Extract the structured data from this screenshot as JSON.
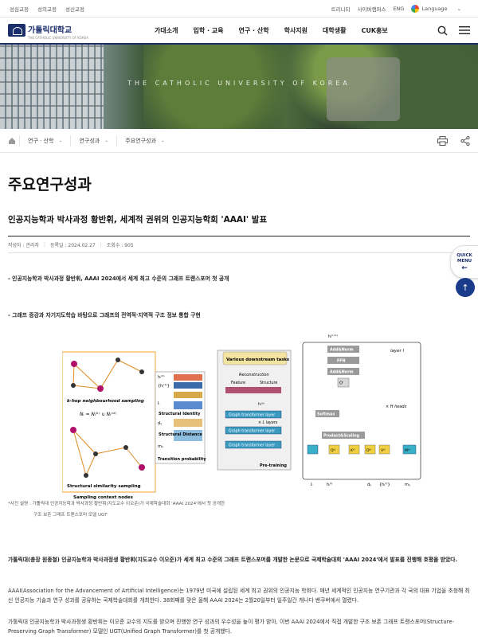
{
  "topbar": {
    "left_links": [
      "성심교정",
      "성의교정",
      "성신교정"
    ],
    "right_links": [
      "트리니티",
      "사이버캠퍼스",
      "ENG"
    ],
    "language": "Language"
  },
  "header": {
    "logo_text": "가톨릭대학교",
    "logo_sub": "THE CATHOLIC UNIVERSITY OF KOREA",
    "nav": [
      "가대소개",
      "입학 · 교육",
      "연구 · 산학",
      "학사지원",
      "대학생활",
      "CUK홍보"
    ]
  },
  "banner": {
    "text": "THE CATHOLIC UNIVERSITY OF KOREA"
  },
  "breadcrumb": [
    "연구 · 산학",
    "연구성과",
    "주요연구성과"
  ],
  "page_title": "주요연구성과",
  "article": {
    "title": "인공지능학과 박사과정 황반휘, 세계적 권위의 인공지능학회 'AAAI' 발표",
    "author_label": "작성자 : 관리자",
    "date_label": "등록일 : 2024.02.27",
    "views_label": "조회수 : 905",
    "bullet1": "- 인공지능학과 박사과정 황반휘, AAAI 2024에서 세계 최고 수준의 그래프 트랜스포머 첫 공개",
    "bullet2": "- 그래프 증강과 자기지도학습 바탕으로 그래프의 전역적·지역적 구조 정보 통합 구현",
    "caption1": "*사진 설명 : 가톨릭대 인공지능학과 박사과정 황반휘(지도교수 이오준)가 국제학술대회 'AAAI 2024'에서 첫 공개한",
    "caption2": "구조 보존 그래프 트랜스포머 모델 UGT",
    "para1": "가톨릭대(총장 원종철) 인공지능학과 박사과정생 황반휘(지도교수 이오준)가 세계 최고 수준의 그래프 트랜스포머를 개발한 논문으로 국제학술대회 'AAAI 2024'에서 발표를 진행해 호평을 받았다.",
    "para2": "AAAI(Association for the Advancement of Artificial Intelligence)는 1979년 미국에 설립된 세계 최고 권위의 인공지능 학회다. 매년 세계적인 인공지능 연구기관과 각 국의 대표 기업을 초청해 최신 인공지능 기술과 연구 성과를 공유하는 국제학술대회를 개최한다. 38회째를 맞은 올해 AAAI 2024는 2월20일부터 일주일간 캐나다 밴쿠버에서 열렸다.",
    "para3": "가톨릭대 인공지능학과 박사과정생 황반휘는 이오준 교수의 지도를 받으며 진행한 연구 성과의 우수성을 높이 평가 받아, 이번 AAAI 2024에서 직접 개발한 구조 보존 그래프 트랜스포머(Structure-Preserving Graph Transformer) 모델인 UGT(Unified Graph Transformer)를 첫 공개했다."
  },
  "figure": {
    "labels": {
      "khop": "k-hop neighbourhood sampling",
      "khop_formula": "Nᵢ = Nᵢ⁽ᵏ⁾ ∪ Nᵢ⁽ˢᵗ⁾",
      "similarity": "Structural similarity sampling",
      "context": "Sampling context nodes",
      "identity": "Structural Identity",
      "distance": "Structural Distance",
      "transition": "Transition probability",
      "downstream": "Various downstream tasks",
      "reconstruction": "Reconstruction",
      "feature": "Feature",
      "structure": "Structure",
      "gtl": "Graph transformer layer",
      "l_layers": "× L layers",
      "pretraining": "Pre-training",
      "layer_l": "layer l",
      "addnorm": "Add&Norm",
      "ffn": "FFN",
      "softmax": "Softmax",
      "prodscale": "Product&Scaling",
      "h_heads": "× H heads",
      "o": "Oˡ",
      "q": "Qᵏˡ",
      "k": "Kᵏˡ",
      "d": "Dᵏˡ",
      "v": "Vᵏˡ",
      "m": "Mᵏˡ",
      "h_out": "hᵢ⁽ˡ⁺¹⁾",
      "h_in_i": "hᵢ⁽ˡ⁾",
      "h_in_j": "{hⱼ⁽ˡ⁾}",
      "i_lbl": "Iᵢ",
      "dij_lbl": "dᵢⱼ",
      "mij_lbl": "mᵢⱼ",
      "hi1": "hᵢ⁽¹⁾",
      "hj1": "{hⱼ⁽¹⁾}",
      "hik": "hᵢ⁽ᵏ⁾"
    }
  },
  "quick_menu": {
    "line1": "QUICK",
    "line2": "MENU"
  },
  "colors": {
    "brand": "#1a2e6c",
    "accent": "#1a3a8a"
  }
}
